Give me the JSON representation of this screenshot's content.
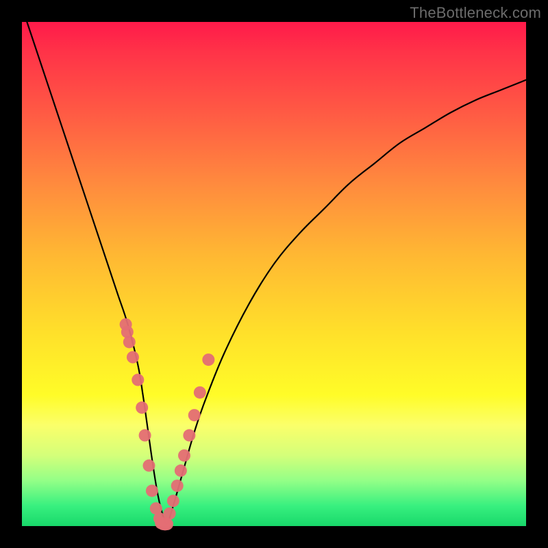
{
  "watermark": "TheBottleneck.com",
  "chart_data": {
    "type": "line",
    "title": "",
    "xlabel": "",
    "ylabel": "",
    "xlim": [
      0,
      100
    ],
    "ylim": [
      0,
      100
    ],
    "grid": false,
    "series": [
      {
        "name": "bottleneck-curve",
        "color": "#000000",
        "x": [
          1,
          3,
          5,
          7,
          9,
          11,
          13,
          15,
          17,
          19,
          21,
          23,
          24,
          25,
          26,
          27,
          28,
          28.8,
          30,
          32,
          34,
          36,
          40,
          45,
          50,
          55,
          60,
          65,
          70,
          75,
          80,
          85,
          90,
          95,
          100
        ],
        "y": [
          100,
          94,
          88,
          82,
          76,
          70,
          64,
          58,
          52,
          46,
          40,
          32,
          26,
          19,
          12,
          6,
          2,
          0.5,
          4,
          11,
          18,
          24,
          34,
          44,
          52,
          58,
          63,
          68,
          72,
          76,
          79,
          82,
          84.5,
          86.5,
          88.5
        ]
      }
    ],
    "markers": [
      {
        "name": "data-points-left",
        "color": "#e46e74",
        "x": [
          20.6,
          20.9,
          21.3,
          22.0,
          23.0,
          23.8,
          24.4,
          25.2,
          25.8,
          26.6,
          27.3
        ],
        "y": [
          40.0,
          38.5,
          36.5,
          33.5,
          29.0,
          23.5,
          18.0,
          12.0,
          7.0,
          3.5,
          1.5
        ]
      },
      {
        "name": "data-points-right",
        "color": "#e46e74",
        "x": [
          28.5,
          29.3,
          30.0,
          30.8,
          31.5,
          32.2,
          33.2,
          34.2,
          35.3,
          37.0
        ],
        "y": [
          0.5,
          2.5,
          5.0,
          8.0,
          11.0,
          14.0,
          18.0,
          22.0,
          26.5,
          33.0
        ]
      },
      {
        "name": "data-points-bottom",
        "color": "#e46e74",
        "x": [
          27.6,
          28.0,
          28.4,
          28.8
        ],
        "y": [
          0.6,
          0.4,
          0.35,
          0.4
        ]
      }
    ]
  }
}
